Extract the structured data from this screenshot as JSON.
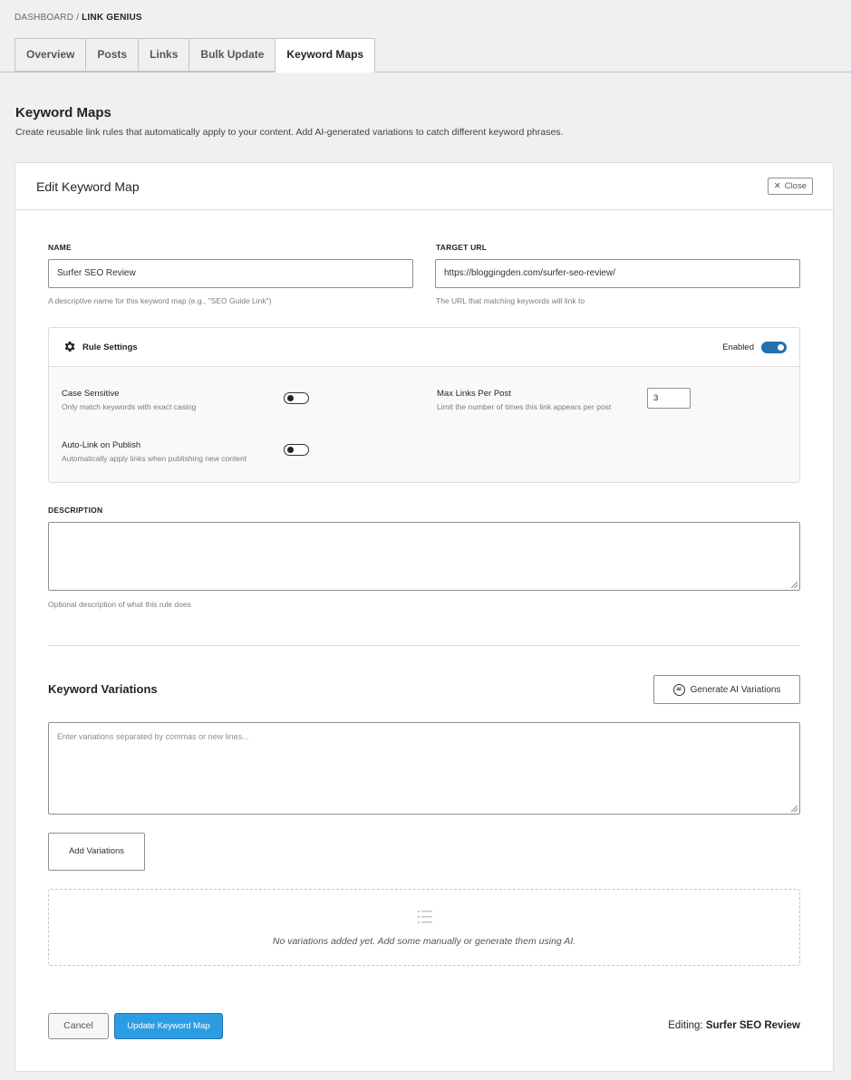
{
  "breadcrumb": {
    "root": "DASHBOARD",
    "separator": "/",
    "current": "LINK GENIUS"
  },
  "tabs": [
    {
      "label": "Overview",
      "active": false
    },
    {
      "label": "Posts",
      "active": false
    },
    {
      "label": "Links",
      "active": false
    },
    {
      "label": "Bulk Update",
      "active": false
    },
    {
      "label": "Keyword Maps",
      "active": true
    }
  ],
  "page": {
    "title": "Keyword Maps",
    "subtitle": "Create reusable link rules that automatically apply to your content. Add AI-generated variations to catch different keyword phrases."
  },
  "card": {
    "title": "Edit Keyword Map",
    "close_label": "Close",
    "close_icon": "close-icon"
  },
  "form": {
    "name_label": "NAME",
    "name_value": "Surfer SEO Review",
    "name_hint": "A descriptive name for this keyword map (e.g., \"SEO Guide Link\")",
    "url_label": "TARGET URL",
    "url_value": "https://bloggingden.com/surfer-seo-review/",
    "url_hint": "The URL that matching keywords will link to",
    "description_label": "DESCRIPTION",
    "description_value": "",
    "description_hint": "Optional description of what this rule does"
  },
  "rules": {
    "title": "Rule Settings",
    "icon": "gear-icon",
    "enabled_label": "Enabled",
    "enabled": true,
    "case_sensitive_title": "Case Sensitive",
    "case_sensitive_desc": "Only match keywords with exact casing",
    "case_sensitive": false,
    "autolink_title": "Auto-Link on Publish",
    "autolink_desc": "Automatically apply links when publishing new content",
    "autolink": false,
    "max_links_title": "Max Links Per Post",
    "max_links_desc": "Limit the number of times this link appears per post",
    "max_links_value": "3"
  },
  "variations": {
    "title": "Keyword Variations",
    "generate_label": "Generate AI Variations",
    "generate_icon": "ai-icon",
    "placeholder": "Enter variations separated by commas or new lines...",
    "add_label": "Add Variations",
    "empty_icon": "list-icon",
    "empty_text": "No variations added yet. Add some manually or generate them using AI."
  },
  "footer": {
    "cancel_label": "Cancel",
    "update_label": "Update Keyword Map",
    "editing_prefix": "Editing:",
    "editing_name": "Surfer SEO Review"
  },
  "colors": {
    "accent": "#2271b1",
    "primary_button": "#2c9de3"
  }
}
